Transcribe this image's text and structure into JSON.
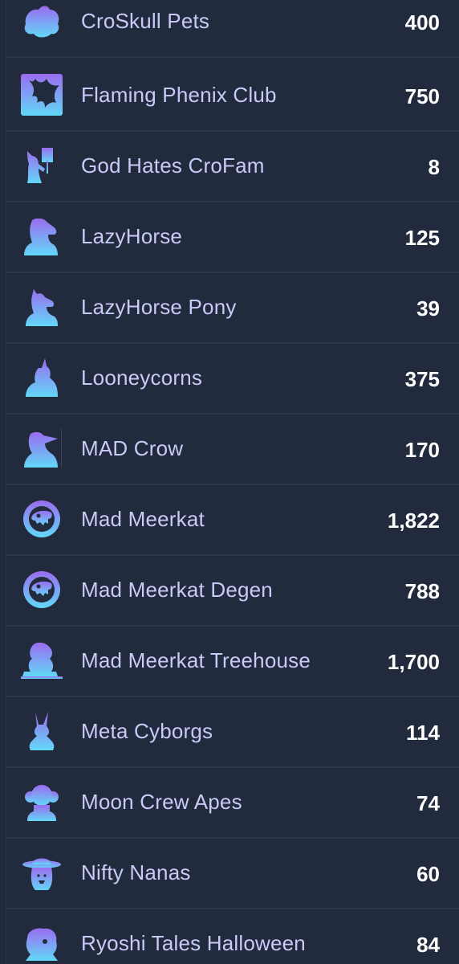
{
  "colors": {
    "background": "#222a3d",
    "divider": "#2e3649",
    "name_text": "#c9cbf7",
    "count_text": "#ffffff",
    "icon_gradient_top": "#9b6cf0",
    "icon_gradient_bottom": "#62d8f7"
  },
  "collections": [
    {
      "name": "CroSkull Pets",
      "count": "400",
      "icon": "croskull-pets-icon"
    },
    {
      "name": "Flaming Phenix Club",
      "count": "750",
      "icon": "phoenix-icon"
    },
    {
      "name": "God Hates CroFam",
      "count": "8",
      "icon": "sign-holder-icon"
    },
    {
      "name": "LazyHorse",
      "count": "125",
      "icon": "horse-icon"
    },
    {
      "name": "LazyHorse Pony",
      "count": "39",
      "icon": "pony-icon"
    },
    {
      "name": "Looneycorns",
      "count": "375",
      "icon": "unicorn-icon"
    },
    {
      "name": "MAD Crow",
      "count": "170",
      "icon": "crow-icon"
    },
    {
      "name": "Mad Meerkat",
      "count": "1,822",
      "icon": "meerkat-badge-icon"
    },
    {
      "name": "Mad Meerkat Degen",
      "count": "788",
      "icon": "meerkat-degen-badge-icon"
    },
    {
      "name": "Mad Meerkat Treehouse",
      "count": "1,700",
      "icon": "treehouse-meerkat-icon"
    },
    {
      "name": "Meta Cyborgs",
      "count": "114",
      "icon": "cyborg-bunny-icon"
    },
    {
      "name": "Moon Crew Apes",
      "count": "74",
      "icon": "ape-icon"
    },
    {
      "name": "Nifty Nanas",
      "count": "60",
      "icon": "nana-hat-icon"
    },
    {
      "name": "Ryoshi Tales Halloween",
      "count": "84",
      "icon": "ryoshi-halloween-icon"
    }
  ]
}
